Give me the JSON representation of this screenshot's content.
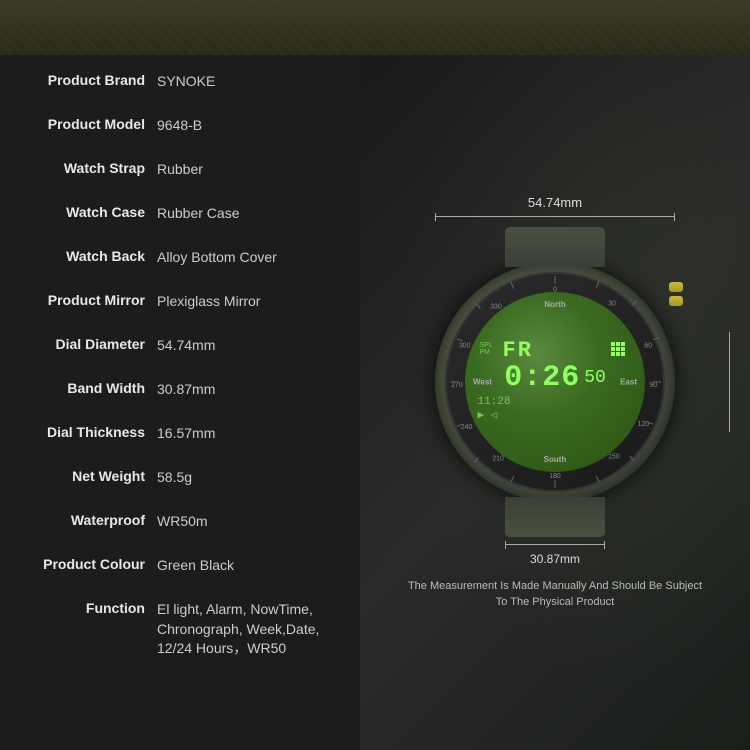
{
  "top_bar": {
    "bg": "#3a3a2a"
  },
  "specs": [
    {
      "label": "Product Brand",
      "value": "SYNOKE"
    },
    {
      "label": "Product Model",
      "value": "9648-B"
    },
    {
      "label": "Watch Strap",
      "value": "Rubber"
    },
    {
      "label": "Watch Case",
      "value": "Rubber Case"
    },
    {
      "label": "Watch Back",
      "value": "Alloy Bottom Cover"
    },
    {
      "label": "Product Mirror",
      "value": "Plexiglass Mirror"
    },
    {
      "label": "Dial Diameter",
      "value": "54.74mm"
    },
    {
      "label": "Band Width",
      "value": "30.87mm"
    },
    {
      "label": "Dial Thickness",
      "value": "16.57mm"
    },
    {
      "label": "Net Weight",
      "value": "58.5g"
    },
    {
      "label": "Waterproof",
      "value": "WR50m"
    },
    {
      "label": "Product Colour",
      "value": "Green  Black"
    },
    {
      "label": "Function",
      "value": "El light, Alarm, NowTime, Chronograph, Week,Date, 12/24 Hours，WR50"
    }
  ],
  "watch": {
    "day": "FR",
    "time": "0:26",
    "seconds": "50",
    "sub_time": "11:28",
    "sub_icons": "▶ ◁",
    "compass": {
      "north": "North",
      "south": "South",
      "east": "East",
      "west": "West"
    }
  },
  "dimensions": {
    "dial_diameter": "54.74mm",
    "band_width": "30.87mm"
  },
  "bottom_note": "The Measurement Is Made Manually And Should\nBe Subject To The Physical Product"
}
